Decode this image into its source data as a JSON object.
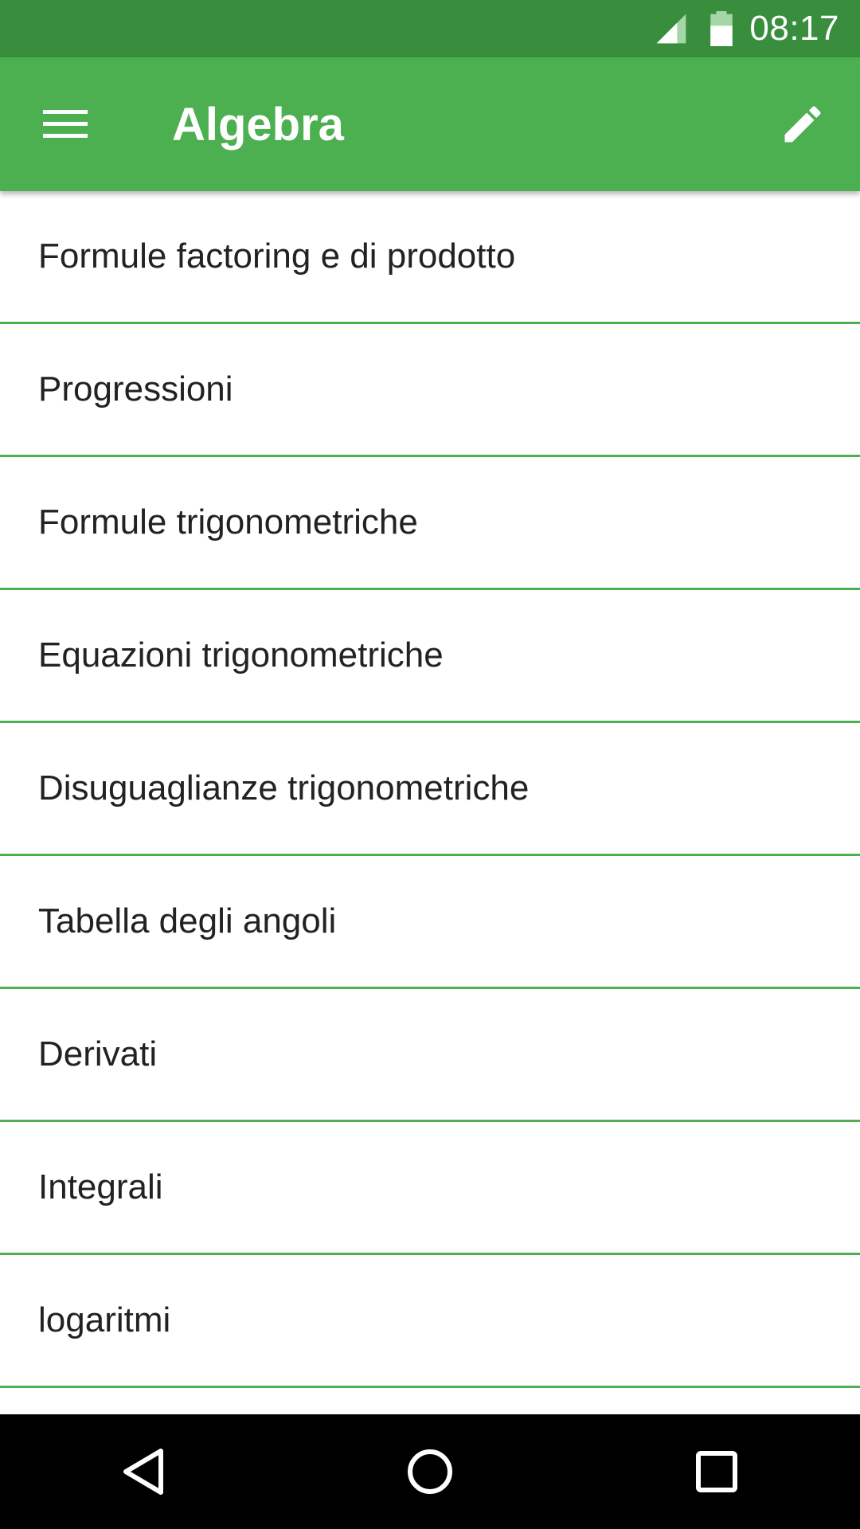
{
  "status_bar": {
    "time": "08:17",
    "icons": [
      "cell-signal-icon",
      "battery-icon"
    ]
  },
  "app_bar": {
    "title": "Algebra",
    "left_icon": "menu-icon",
    "right_icon": "edit-icon"
  },
  "list": {
    "items": [
      {
        "label": "Formule factoring e di prodotto"
      },
      {
        "label": "Progressioni"
      },
      {
        "label": "Formule trigonometriche"
      },
      {
        "label": "Equazioni trigonometriche"
      },
      {
        "label": "Disuguaglianze trigonometriche"
      },
      {
        "label": "Tabella degli angoli"
      },
      {
        "label": "Derivati"
      },
      {
        "label": "Integrali"
      },
      {
        "label": "logaritmi"
      }
    ]
  },
  "nav_bar": {
    "icons": [
      "back-icon",
      "home-icon",
      "recents-icon"
    ]
  },
  "colors": {
    "status_bar": "#388e3c",
    "app_bar": "#4caf50",
    "divider": "#4caf50",
    "nav_bar": "#000000"
  }
}
